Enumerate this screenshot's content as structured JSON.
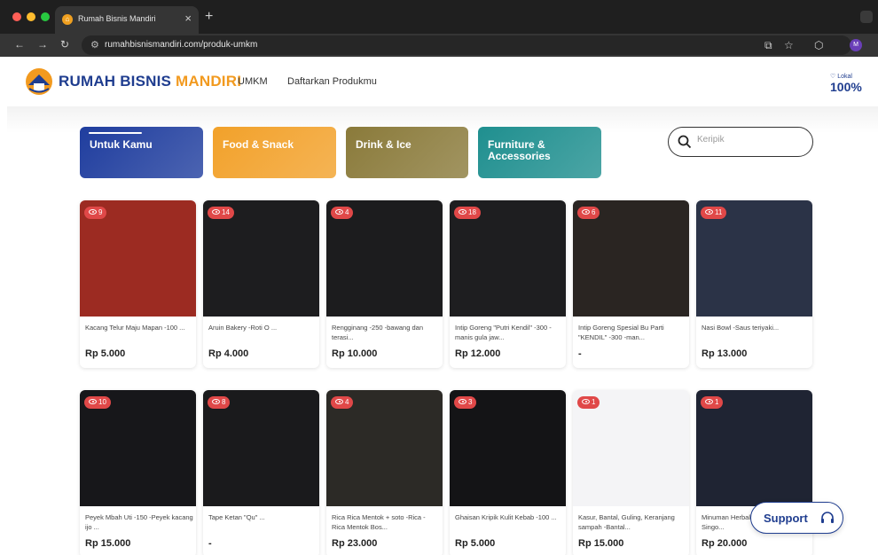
{
  "browser": {
    "tab_title": "Rumah Bisnis Mandiri",
    "url": "rumahbisnismandiri.com/produk-umkm",
    "profile_initial": "M",
    "traffic_colors": [
      "#ff5f57",
      "#febc2e",
      "#28c840"
    ]
  },
  "header": {
    "brand_part1": "RUMAH BISNIS ",
    "brand_part2": "MANDIRI",
    "nav": [
      "UMKM",
      "Daftarkan Produkmu"
    ],
    "lokal_label": "Lokal",
    "lokal_value": "100%"
  },
  "categories": [
    {
      "label": "Untuk Kamu",
      "color": "#1f3d9e",
      "active": true
    },
    {
      "label": "Food & Snack",
      "color": "#f2a12a",
      "active": false
    },
    {
      "label": "Drink & Ice",
      "color": "#8a7a3a",
      "active": false
    },
    {
      "label": "Furniture & Accessories",
      "color": "#1f8f8f",
      "active": false
    }
  ],
  "search": {
    "placeholder": "Keripik"
  },
  "products": [
    {
      "views": "9",
      "name": "Kacang Telur Maju Mapan -100 ...",
      "price": "Rp 5.000",
      "bg": "#9c2b22"
    },
    {
      "views": "14",
      "name": "Aruin Bakery -Roti O ...",
      "price": "Rp 4.000",
      "bg": "#1d1d1f"
    },
    {
      "views": "4",
      "name": "Rengginang -250 -bawang dan terasi...",
      "price": "Rp 10.000",
      "bg": "#1c1c1e"
    },
    {
      "views": "18",
      "name": "Intip Goreng \"Putri Kendil\" -300 -manis gula jaw...",
      "price": "Rp 12.000",
      "bg": "#1e1e20"
    },
    {
      "views": "6",
      "name": "Intip Goreng Spesial Bu Parti \"KENDIL\" -300 -man...",
      "price": "-",
      "bg": "#2a2522"
    },
    {
      "views": "11",
      "name": "Nasi Bowl -Saus teriyaki...",
      "price": "Rp 13.000",
      "bg": "#2b3347"
    },
    {
      "views": "10",
      "name": "Peyek Mbah Uti -150 -Peyek kacang ijo ...",
      "price": "Rp 15.000",
      "bg": "#17171a"
    },
    {
      "views": "8",
      "name": "Tape Ketan \"Qu\" ...",
      "price": "-",
      "bg": "#1a1a1c"
    },
    {
      "views": "4",
      "name": "Rica Rica Mentok + soto -Rica - Rica Mentok Bos...",
      "price": "Rp 23.000",
      "bg": "#2c2a26"
    },
    {
      "views": "3",
      "name": "Ghaisan Kripik Kulit Kebab -100 ...",
      "price": "Rp 5.000",
      "bg": "#141416"
    },
    {
      "views": "1",
      "name": "Kasur, Bantal, Guling, Keranjang sampah -Bantal...",
      "price": "Rp 15.000",
      "bg": "#f4f4f6"
    },
    {
      "views": "1",
      "name": "Minuman Herbal Jawa - Rempon Singo...",
      "price": "Rp 20.000",
      "bg": "#1f2433"
    }
  ],
  "support": {
    "label": "Support"
  }
}
